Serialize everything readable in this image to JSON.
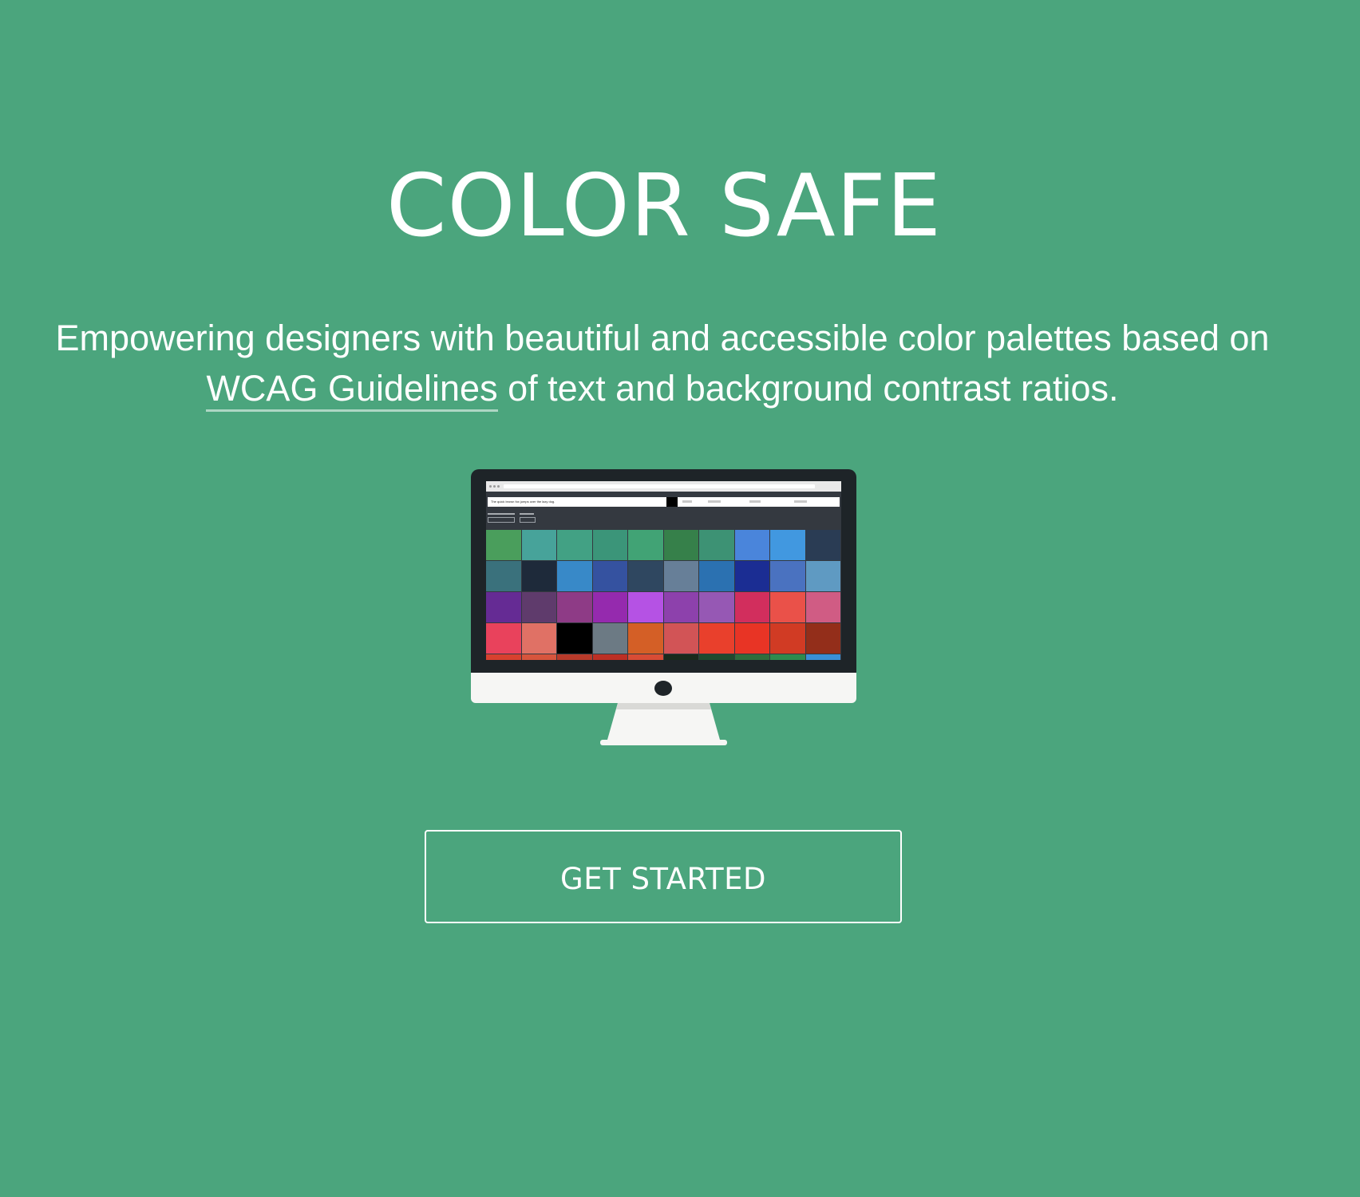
{
  "hero": {
    "title": "COLOR SAFE",
    "subtitle_part1": "Empowering designers with beautiful and accessible color palettes based on",
    "subtitle_link": "WCAG Guidelines",
    "subtitle_part2": " of text and background contrast ratios."
  },
  "screenshot": {
    "preview_text": "The quick brown fox jumps over the lazy dog."
  },
  "cta": {
    "label": "GET STARTED"
  },
  "colors": {
    "background": "#4ba57d",
    "text": "#ffffff"
  },
  "palette_rows": [
    [
      "#4a9e5c",
      "#47a39a",
      "#42a184",
      "#3b9579",
      "#41a375",
      "#36804a",
      "#3d9274",
      "#4a85db",
      "#4198e0",
      "#2a3c54"
    ],
    [
      "#3a717c",
      "#1e2a3a",
      "#3889c8",
      "#3552a0",
      "#2f4760",
      "#677f98",
      "#2b71b1",
      "#1b2d93",
      "#4a72c0",
      "#5f9ac2"
    ],
    [
      "#652b94",
      "#5f3b6c",
      "#8e3b86",
      "#952aae",
      "#b552e4",
      "#8d41ac",
      "#9658b4",
      "#d22e5d",
      "#ea5149",
      "#d05c84"
    ],
    [
      "#e9425c",
      "#e07165",
      "#000000",
      "#6c7a84",
      "#d45f26",
      "#d25456",
      "#e9402c",
      "#e83425",
      "#d13b24",
      "#932e1a"
    ],
    [
      "#d8412f",
      "#d7553d",
      "#b83a2a",
      "#bd2f24",
      "#d84c35",
      "#1a2a1c",
      "#1f4a2e",
      "#2f6c3c",
      "#2e8a4e",
      "#3a8fd6"
    ]
  ]
}
